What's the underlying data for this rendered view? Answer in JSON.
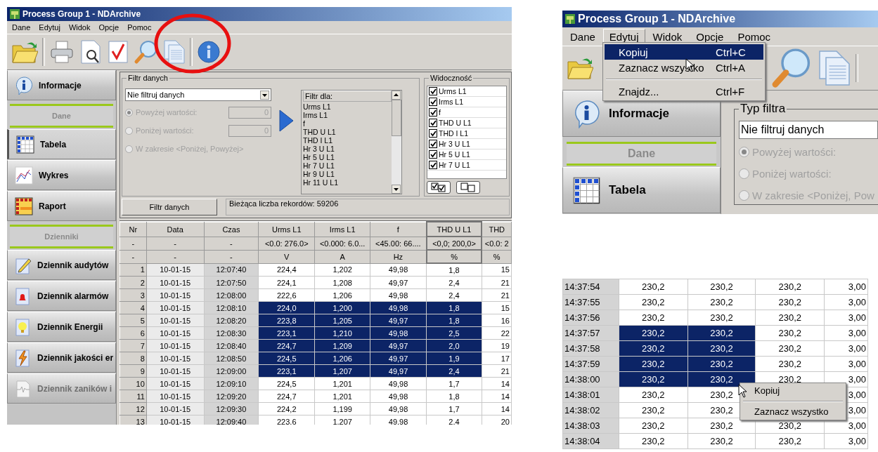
{
  "left_window": {
    "title": "Process Group 1 - NDArchive",
    "menu": [
      "Dane",
      "Edytuj",
      "Widok",
      "Opcje",
      "Pomoc"
    ],
    "sidebar": [
      {
        "kind": "item",
        "label": "Informacje",
        "selected": false,
        "disabled": false
      },
      {
        "kind": "header",
        "label": "Dane"
      },
      {
        "kind": "item",
        "label": "Tabela",
        "selected": true,
        "disabled": false
      },
      {
        "kind": "item",
        "label": "Wykres",
        "selected": false,
        "disabled": false
      },
      {
        "kind": "item",
        "label": "Raport",
        "selected": false,
        "disabled": false
      },
      {
        "kind": "header",
        "label": "Dzienniki"
      },
      {
        "kind": "item",
        "label": "Dziennik audytów",
        "selected": false,
        "disabled": false
      },
      {
        "kind": "item",
        "label": "Dziennik alarmów",
        "selected": false,
        "disabled": false
      },
      {
        "kind": "item",
        "label": "Dziennik Energii",
        "selected": false,
        "disabled": false
      },
      {
        "kind": "item",
        "label": "Dziennik jakości er",
        "selected": false,
        "disabled": false
      },
      {
        "kind": "item",
        "label": "Dziennik zaników i",
        "selected": false,
        "disabled": true
      }
    ],
    "filter": {
      "title": "Filtr danych",
      "dropdown": "Nie filtruj danych",
      "options": [
        {
          "label": "Powyżej wartości:",
          "checked": true,
          "disabled": true,
          "value": "0"
        },
        {
          "label": "Poniżej wartości:",
          "checked": false,
          "disabled": true,
          "value": "0"
        },
        {
          "label": "W zakresie <Poniżej, Powyżej>",
          "checked": false,
          "disabled": true
        }
      ],
      "list_header": "Filtr dla:",
      "list_items": [
        "Urms L1",
        "Irms L1",
        "f",
        "THD U L1",
        "THD I L1",
        "Hr 3 U L1",
        "Hr 5 U L1",
        "Hr 7 U L1",
        "Hr 9 U L1",
        "Hr 11 U L1"
      ]
    },
    "visibility": {
      "title": "Widoczność",
      "items": [
        {
          "label": "Urms L1",
          "checked": true
        },
        {
          "label": "Irms L1",
          "checked": true
        },
        {
          "label": "f",
          "checked": true
        },
        {
          "label": "THD U L1",
          "checked": true
        },
        {
          "label": "THD I L1",
          "checked": true
        },
        {
          "label": "Hr 3 U L1",
          "checked": true
        },
        {
          "label": "Hr 5 U L1",
          "checked": true
        },
        {
          "label": "Hr 7 U L1",
          "checked": true
        }
      ]
    },
    "filter_button": "Filtr danych",
    "record_count": "Bieżąca liczba rekordów: 59206",
    "table": {
      "columns": [
        {
          "title": "Nr",
          "range": "-",
          "unit": "-"
        },
        {
          "title": "Data",
          "range": "-",
          "unit": "-"
        },
        {
          "title": "Czas",
          "range": "-",
          "unit": "-"
        },
        {
          "title": "Urms L1",
          "range": "<0.0: 276.0>",
          "unit": "V"
        },
        {
          "title": "Irms L1",
          "range": "<0.000: 6.0...",
          "unit": "A"
        },
        {
          "title": "f",
          "range": "<45.00: 66....",
          "unit": "Hz"
        },
        {
          "title": "THD U L1",
          "range": "<0,0; 200,0>",
          "unit": "%"
        },
        {
          "title": "THD",
          "range": "<0.0: 2",
          "unit": "%"
        }
      ],
      "rows": [
        {
          "nr": "1",
          "date": "10-01-15",
          "time": "12:07:40",
          "values": [
            "224,4",
            "1,202",
            "49,98",
            "1,8",
            "15"
          ],
          "selected": false
        },
        {
          "nr": "2",
          "date": "10-01-15",
          "time": "12:07:50",
          "values": [
            "224,1",
            "1,208",
            "49,97",
            "2,4",
            "21"
          ],
          "selected": false
        },
        {
          "nr": "3",
          "date": "10-01-15",
          "time": "12:08:00",
          "values": [
            "222,6",
            "1,206",
            "49,98",
            "2,4",
            "21"
          ],
          "selected": false
        },
        {
          "nr": "4",
          "date": "10-01-15",
          "time": "12:08:10",
          "values": [
            "224,0",
            "1,200",
            "49,98",
            "1,8",
            "15"
          ],
          "selected": true
        },
        {
          "nr": "5",
          "date": "10-01-15",
          "time": "12:08:20",
          "values": [
            "223,8",
            "1,205",
            "49,97",
            "1,8",
            "16"
          ],
          "selected": true
        },
        {
          "nr": "6",
          "date": "10-01-15",
          "time": "12:08:30",
          "values": [
            "223,1",
            "1,210",
            "49,98",
            "2,5",
            "22"
          ],
          "selected": true
        },
        {
          "nr": "7",
          "date": "10-01-15",
          "time": "12:08:40",
          "values": [
            "224,7",
            "1,209",
            "49,97",
            "2,0",
            "19"
          ],
          "selected": true
        },
        {
          "nr": "8",
          "date": "10-01-15",
          "time": "12:08:50",
          "values": [
            "224,5",
            "1,206",
            "49,97",
            "1,9",
            "17"
          ],
          "selected": true
        },
        {
          "nr": "9",
          "date": "10-01-15",
          "time": "12:09:00",
          "values": [
            "223,1",
            "1,207",
            "49,97",
            "2,4",
            "21"
          ],
          "selected": true
        },
        {
          "nr": "10",
          "date": "10-01-15",
          "time": "12:09:10",
          "values": [
            "224,5",
            "1,201",
            "49,98",
            "1,7",
            "14"
          ],
          "selected": false
        },
        {
          "nr": "11",
          "date": "10-01-15",
          "time": "12:09:20",
          "values": [
            "224,7",
            "1,201",
            "49,98",
            "1,8",
            "14"
          ],
          "selected": false
        },
        {
          "nr": "12",
          "date": "10-01-15",
          "time": "12:09:30",
          "values": [
            "224,2",
            "1,199",
            "49,98",
            "1,7",
            "14"
          ],
          "selected": false
        },
        {
          "nr": "13",
          "date": "10-01-15",
          "time": "12:09:40",
          "values": [
            "223,6",
            "1,207",
            "49,98",
            "2,4",
            "20"
          ],
          "selected": false
        }
      ]
    }
  },
  "right_window": {
    "title": "Process Group 1 - NDArchive",
    "menu": [
      {
        "label": "Dane",
        "open": false
      },
      {
        "label": "Edytuj",
        "open": true
      },
      {
        "label": "Widok",
        "open": false
      },
      {
        "label": "Opcje",
        "open": false
      },
      {
        "label": "Pomoc",
        "open": false
      }
    ],
    "edit_menu": [
      {
        "kind": "item",
        "label": "Kopiuj",
        "shortcut": "Ctrl+C",
        "selected": true
      },
      {
        "kind": "item",
        "label": "Zaznacz wszystko",
        "shortcut": "Ctrl+A",
        "selected": false
      },
      {
        "kind": "separator"
      },
      {
        "kind": "item",
        "label": "Znajdz...",
        "shortcut": "Ctrl+F",
        "selected": false
      }
    ],
    "sidebar": [
      {
        "kind": "item",
        "label": "Informacje"
      },
      {
        "kind": "header",
        "label": "Dane"
      },
      {
        "kind": "item",
        "label": "Tabela"
      }
    ],
    "filter": {
      "title": "Typ filtra",
      "dropdown": "Nie filtruj danych",
      "options": [
        {
          "label": "Powyżej wartości:",
          "checked": true
        },
        {
          "label": "Poniżej wartości:",
          "checked": false
        },
        {
          "label": "W zakresie <Poniżej, Pow",
          "checked": false
        }
      ]
    }
  },
  "table_excerpt": {
    "rows": [
      {
        "time": "14:37:54",
        "values": [
          "230,2",
          "230,2",
          "230,2"
        ],
        "column_5": "3,00",
        "selected": false
      },
      {
        "time": "14:37:55",
        "values": [
          "230,2",
          "230,2",
          "230,2"
        ],
        "column_5": "3,00",
        "selected": false
      },
      {
        "time": "14:37:56",
        "values": [
          "230,2",
          "230,2",
          "230,2"
        ],
        "column_5": "3,00",
        "selected": false
      },
      {
        "time": "14:37:57",
        "values": [
          "230,2",
          "230,2",
          "230,2"
        ],
        "column_5": "3,00",
        "selected": true
      },
      {
        "time": "14:37:58",
        "values": [
          "230,2",
          "230,2",
          "230,2"
        ],
        "column_5": "3,00",
        "selected": true
      },
      {
        "time": "14:37:59",
        "values": [
          "230,2",
          "230,2",
          "230,2"
        ],
        "column_5": "3,00",
        "selected": true
      },
      {
        "time": "14:38:00",
        "values": [
          "230,2",
          "230,2",
          "230,2"
        ],
        "column_5": "3,00",
        "selected": true
      },
      {
        "time": "14:38:01",
        "values": [
          "230,2",
          "230,2"
        ],
        "column_5": "3,00",
        "selected": false
      },
      {
        "time": "14:38:02",
        "values": [
          "230,2",
          "230,2"
        ],
        "column_5": "3,00",
        "selected": false
      },
      {
        "time": "14:38:03",
        "values": [
          "230,2",
          "230,2",
          "230,2"
        ],
        "column_5": "3,00",
        "selected": false
      },
      {
        "time": "14:38:04",
        "values": [
          "230,2",
          "230,2",
          "230,2"
        ],
        "column_5": "3,00",
        "selected": false
      }
    ],
    "context_menu": [
      {
        "kind": "item",
        "label": "Kopiuj"
      },
      {
        "kind": "separator"
      },
      {
        "kind": "item",
        "label": "Zaznacz wszystko"
      }
    ]
  }
}
